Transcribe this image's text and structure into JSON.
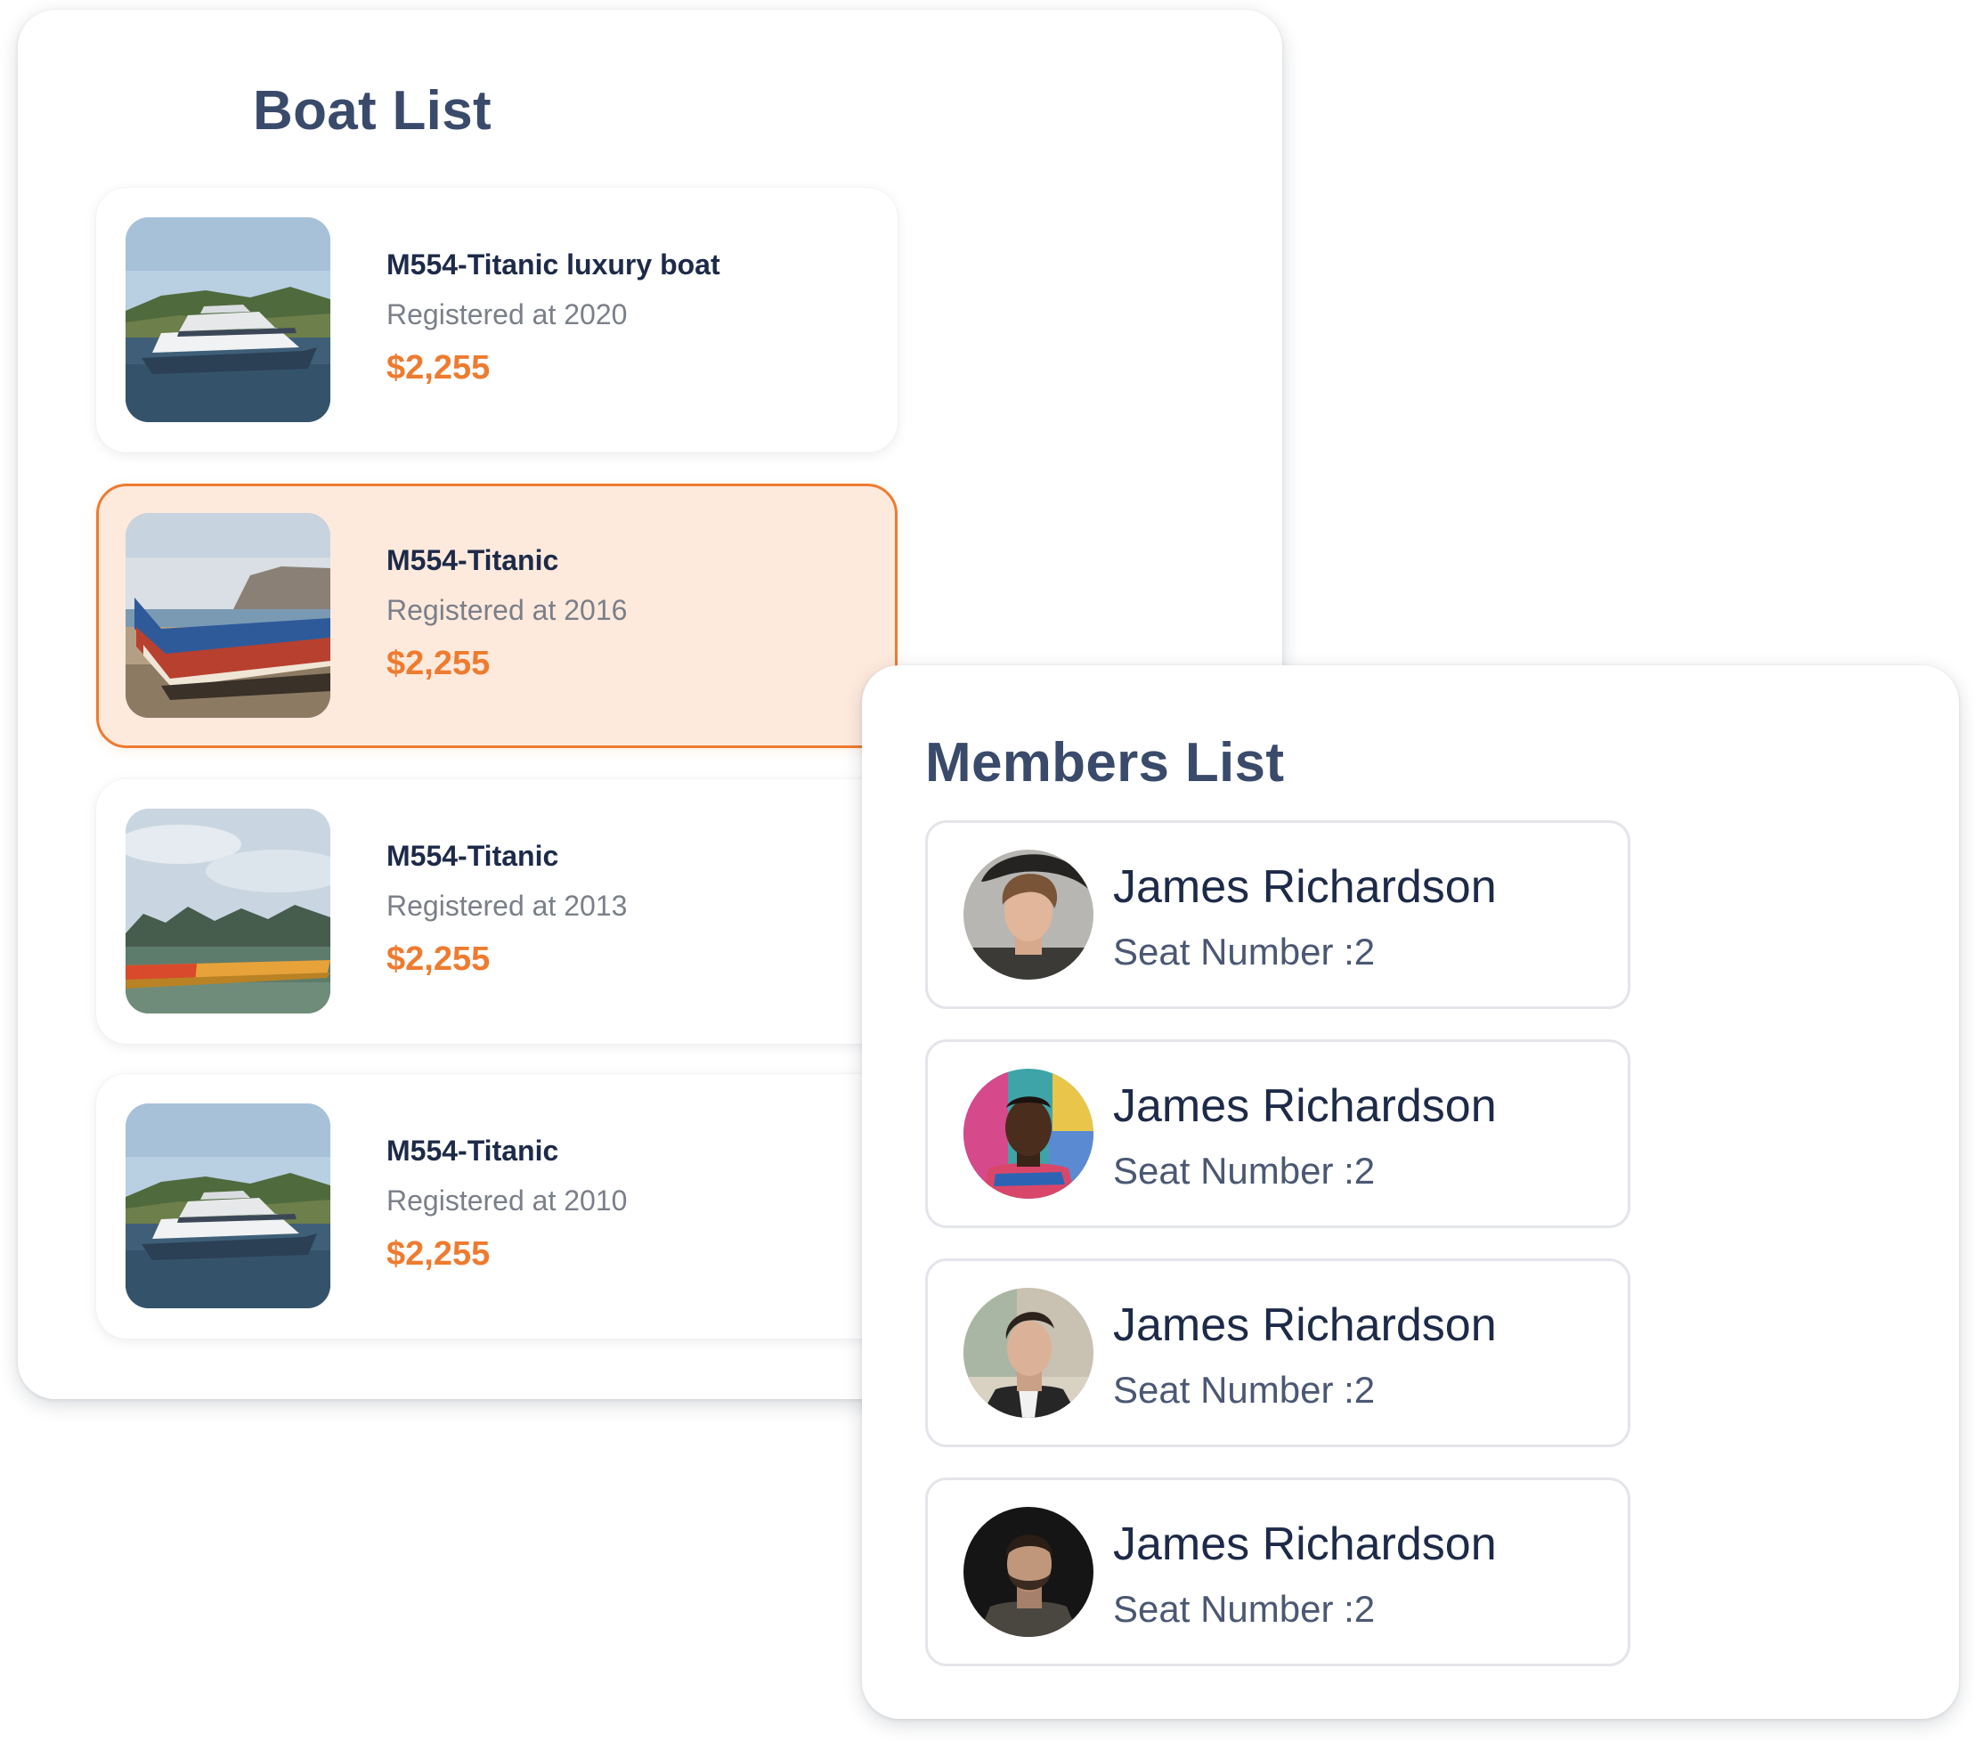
{
  "boat_list": {
    "title": "Boat List",
    "selected_index": 1,
    "items": [
      {
        "name": "M554-Titanic luxury boat",
        "registered": "Registered at 2020",
        "price": "$2,255",
        "image": "luxury-yacht-photo"
      },
      {
        "name": "M554-Titanic",
        "registered": "Registered at 2016",
        "price": "$2,255",
        "image": "wooden-fishing-boat-photo"
      },
      {
        "name": "M554-Titanic",
        "registered": "Registered at 2013",
        "price": "$2,255",
        "image": "kayak-on-lake-photo"
      },
      {
        "name": "M554-Titanic",
        "registered": "Registered at 2010",
        "price": "$2,255",
        "image": "luxury-yacht-photo"
      }
    ]
  },
  "members_list": {
    "title": "Members List",
    "items": [
      {
        "name": "James Richardson",
        "seat": "Seat Number :2",
        "avatar": "curly-hair-man-photo"
      },
      {
        "name": "James Richardson",
        "seat": "Seat Number :2",
        "avatar": "man-graffiti-wall-photo"
      },
      {
        "name": "James Richardson",
        "seat": "Seat Number :2",
        "avatar": "man-styled-hair-photo"
      },
      {
        "name": "James Richardson",
        "seat": "Seat Number :2",
        "avatar": "bearded-man-dark-photo"
      }
    ]
  },
  "colors": {
    "accent": "#ee7b2f",
    "selected_background": "#feeadd",
    "title_text": "#3a4a6b",
    "primary_text": "#1d2a48",
    "secondary_text": "#7a7f89",
    "card_border": "#e3e5ea"
  }
}
